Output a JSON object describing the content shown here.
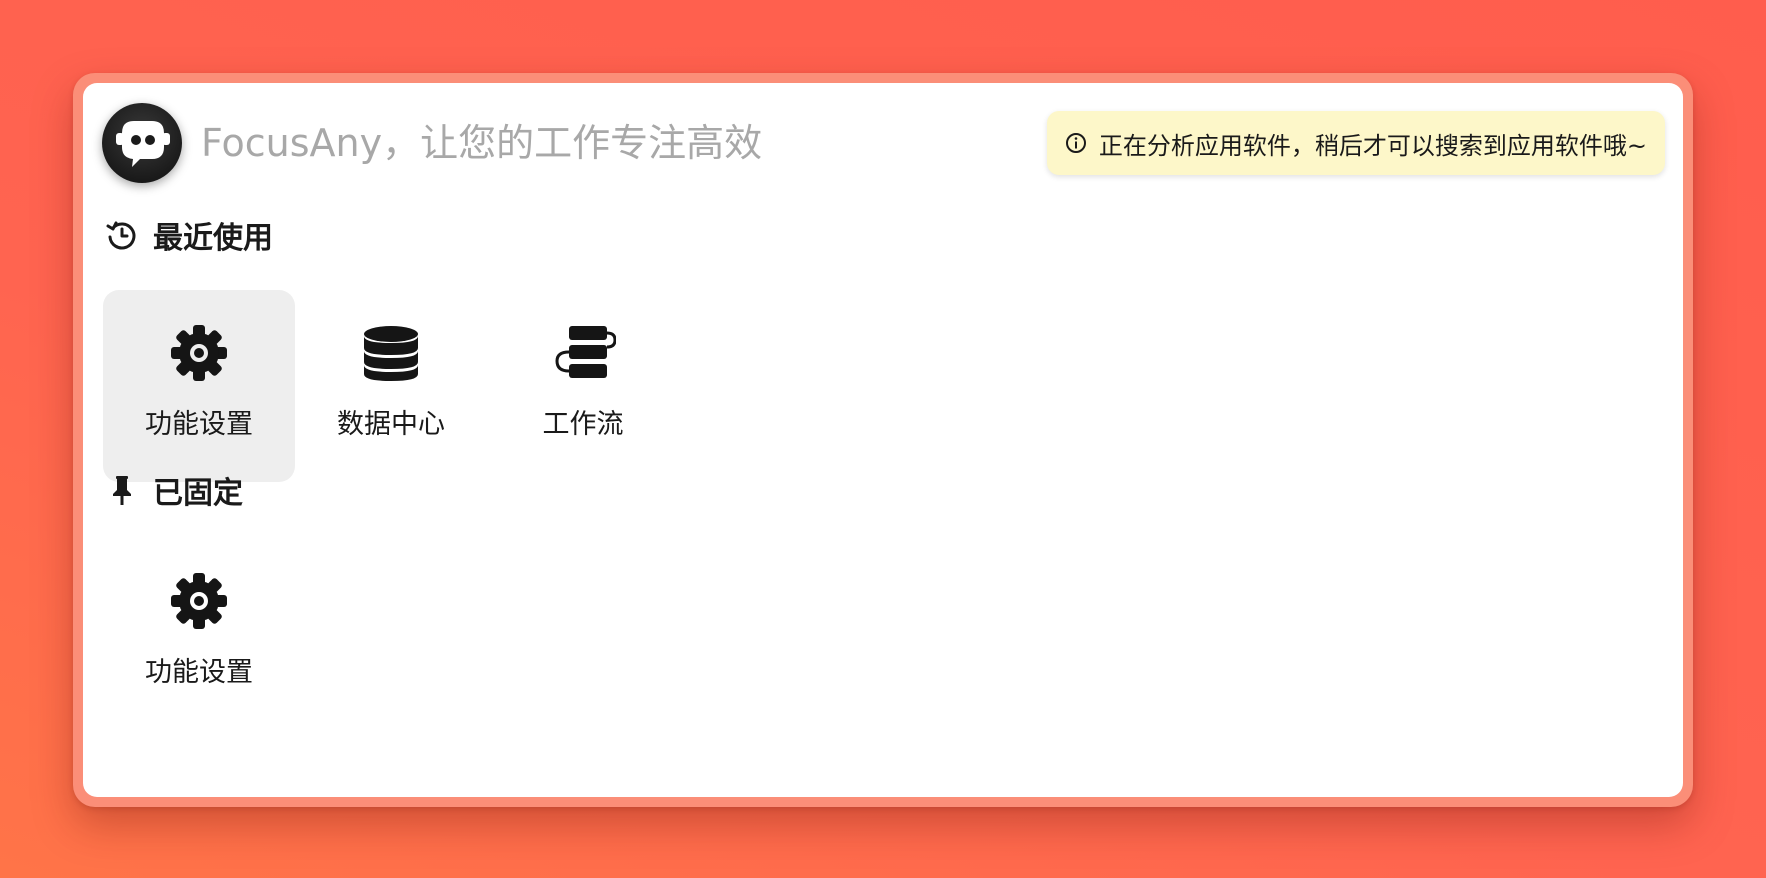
{
  "search": {
    "placeholder": "FocusAny，让您的工作专注高效",
    "value": ""
  },
  "logo": {
    "icon": "robot-chat-logo"
  },
  "notice": {
    "icon": "info-circle-icon",
    "text": "正在分析应用软件，稍后才可以搜索到应用软件哦~",
    "background": "#fdf7c9"
  },
  "sections": {
    "recent": {
      "icon": "history-clock-icon",
      "title": "最近使用",
      "items": [
        {
          "icon": "gear-icon",
          "label": "功能设置",
          "active": true
        },
        {
          "icon": "database-icon",
          "label": "数据中心",
          "active": false
        },
        {
          "icon": "workflow-icon",
          "label": "工作流",
          "active": false
        }
      ]
    },
    "pinned": {
      "icon": "pin-icon",
      "title": "已固定",
      "items": [
        {
          "icon": "gear-icon",
          "label": "功能设置",
          "active": false
        }
      ]
    }
  },
  "colors": {
    "background": "#ff6450",
    "frame": "#fb8e78",
    "active_item": "#eeeeee",
    "text": "#1a1a1a",
    "placeholder": "#a8a8a8"
  }
}
